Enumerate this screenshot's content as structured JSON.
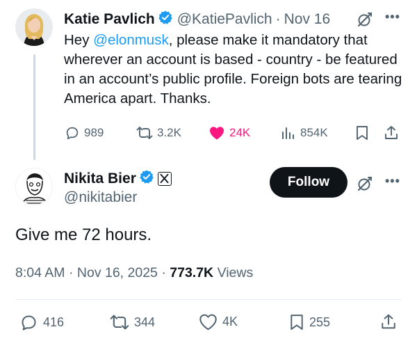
{
  "original_tweet": {
    "author_name": "Katie Pavlich",
    "handle": "@KatiePavlich",
    "separator": "·",
    "date": "Nov 16",
    "text_before": "Hey ",
    "mention": "@elonmusk",
    "text_after": ", please make it mandatory that wherever an account is based - country - be featured in an account’s public profile. Foreign bots are tearing America apart. Thanks.",
    "replies": "989",
    "reposts": "3.2K",
    "likes": "24K",
    "views": "854K"
  },
  "reply_tweet": {
    "author_name": "Nikita Bier",
    "handle": "@nikitabier",
    "follow_label": "Follow",
    "text": "Give me 72 hours.",
    "time": "8:04 AM",
    "sep1": "·",
    "date": "Nov 16, 2025",
    "sep2": "·",
    "views_count": "773.7K",
    "views_label": "Views",
    "replies": "416",
    "reposts": "344",
    "likes": "4K",
    "bookmarks": "255"
  },
  "icons": [
    "verified-badge-icon",
    "grok-icon",
    "more-icon",
    "reply-icon",
    "repost-icon",
    "heart-icon",
    "views-icon",
    "bookmark-icon",
    "share-icon",
    "x-logo-icon"
  ],
  "colors": {
    "accent": "#1d9bf0",
    "like": "#f91880",
    "text": "#0f1419",
    "secondary": "#536471",
    "follow_bg": "#0f1419"
  }
}
